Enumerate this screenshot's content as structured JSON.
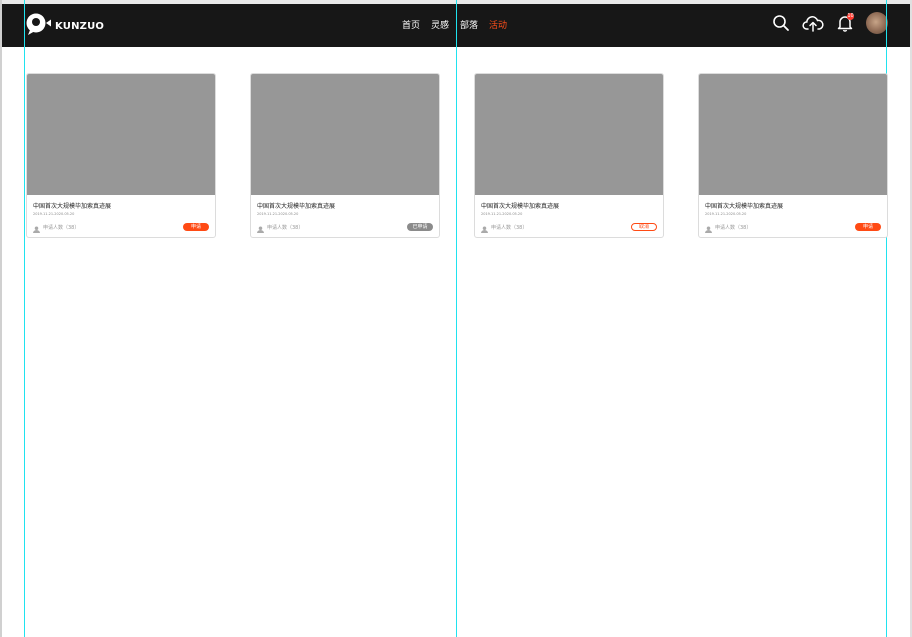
{
  "brand": {
    "name": "KUNZUO"
  },
  "nav": [
    {
      "label": "首页"
    },
    {
      "label": "灵感"
    },
    {
      "label": "部落"
    },
    {
      "label": "活动",
      "active": true
    }
  ],
  "header": {
    "notification_badge": "10"
  },
  "cards": [
    {
      "title": "中国首次大规模毕加索真迹展",
      "date": "2019.11.21-2020.05.20",
      "apply_count": "申请人数（38）",
      "button": "申请",
      "status": "apply"
    },
    {
      "title": "中国首次大规模毕加索真迹展",
      "date": "2019.11.21-2020.05.20",
      "apply_count": "申请人数（38）",
      "button": "已申请",
      "status": "applied"
    },
    {
      "title": "中国首次大规模毕加索真迹展",
      "date": "2019.11.21-2020.05.20",
      "apply_count": "申请人数（38）",
      "button": "取消",
      "status": "cancel"
    },
    {
      "title": "中国首次大规模毕加索真迹展",
      "date": "2019.11.21-2020.05.20",
      "apply_count": "申请人数（38）",
      "button": "申请",
      "status": "apply"
    }
  ],
  "colors": {
    "accent": "#ff4a14",
    "topbar": "#171717",
    "guide": "#1fe3ef",
    "placeholder": "#979797"
  },
  "icons": [
    "logo-camera-icon",
    "search-icon",
    "upload-cloud-icon",
    "bell-icon",
    "user-icon"
  ]
}
